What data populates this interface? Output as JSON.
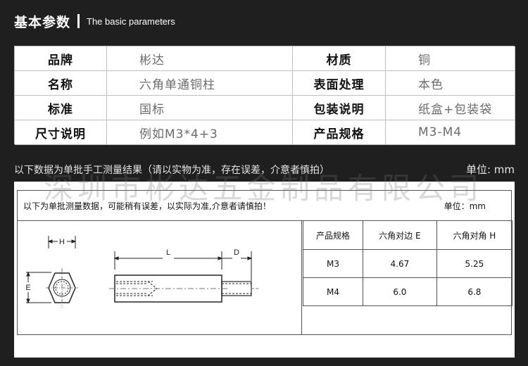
{
  "header": {
    "title_cn": "基本参数",
    "title_en": "The basic parameters"
  },
  "params": [
    {
      "label": "品牌",
      "value": "彬达",
      "label2": "材质",
      "value2": "铜"
    },
    {
      "label": "名称",
      "value": "六角单通铜柱",
      "label2": "表面处理",
      "value2": "本色"
    },
    {
      "label": "标准",
      "value": "国标",
      "label2": "包装说明",
      "value2": "纸盒+包装袋"
    },
    {
      "label": "尺寸说明",
      "value": "例如M3*4+3",
      "label2": "产品规格",
      "value2": "M3-M4"
    }
  ],
  "note": {
    "text": "以下数据为单批手工测量结果（请以实物为准，存在误差，介意者慎拍）",
    "unit": "单位: mm"
  },
  "watermark": "深圳市彬达五金制品有限公司",
  "card": {
    "top_text": "以下为单批测量数据，可能稍有误差，以实际为准,介意者请慎拍！",
    "top_unit": "单位：mm",
    "diagram_labels": {
      "H": "H",
      "E": "E",
      "L": "L",
      "D": "D"
    },
    "table": {
      "headers": [
        "产品规格",
        "六角对边 E",
        "六角对角 H"
      ],
      "rows": [
        [
          "M3",
          "4.67",
          "5.25"
        ],
        [
          "M4",
          "6.0",
          "6.8"
        ]
      ]
    }
  }
}
